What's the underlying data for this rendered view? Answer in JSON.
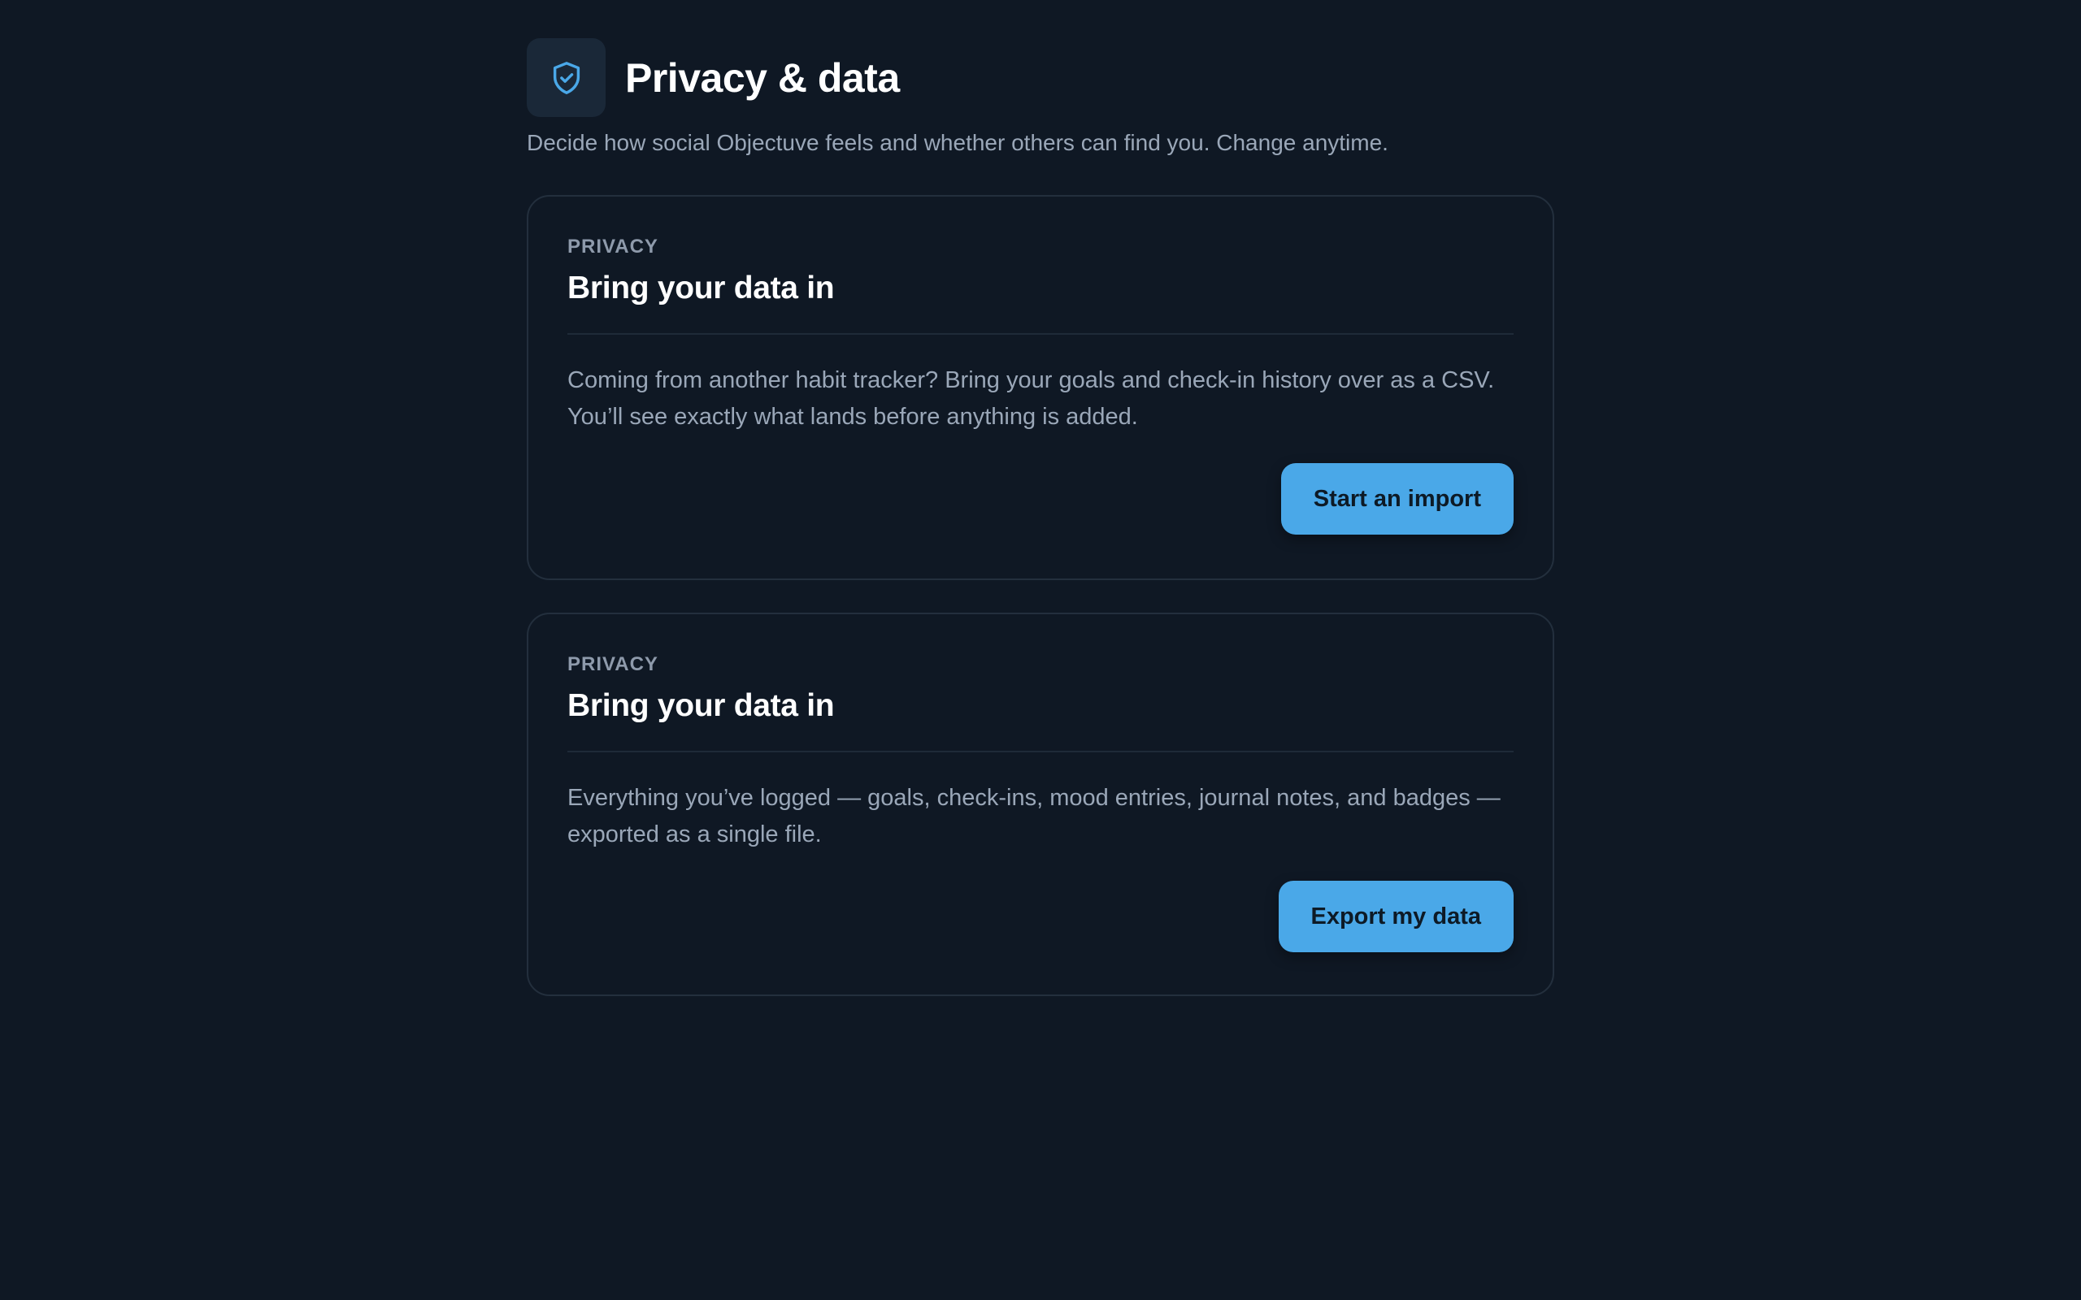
{
  "header": {
    "title": "Privacy & data",
    "subtitle": "Decide how social Objectuve feels and whether others can find you. Change anytime.",
    "icon": "shield-check-icon"
  },
  "cards": [
    {
      "eyebrow": "PRIVACY",
      "title": "Bring your data in",
      "body": "Coming from another habit tracker? Bring your goals and check-in history over as a CSV. You’ll see exactly what lands before anything is added.",
      "button_label": "Start an import"
    },
    {
      "eyebrow": "PRIVACY",
      "title": "Bring your data in",
      "body": "Everything you’ve logged — goals, check-ins, mood entries, journal notes, and badges — exported as a single file.",
      "button_label": "Export my data"
    }
  ],
  "colors": {
    "background": "#0f1824",
    "accent": "#4aa8e8",
    "card_border": "#232f3d",
    "muted_text": "#9aa7b8"
  }
}
